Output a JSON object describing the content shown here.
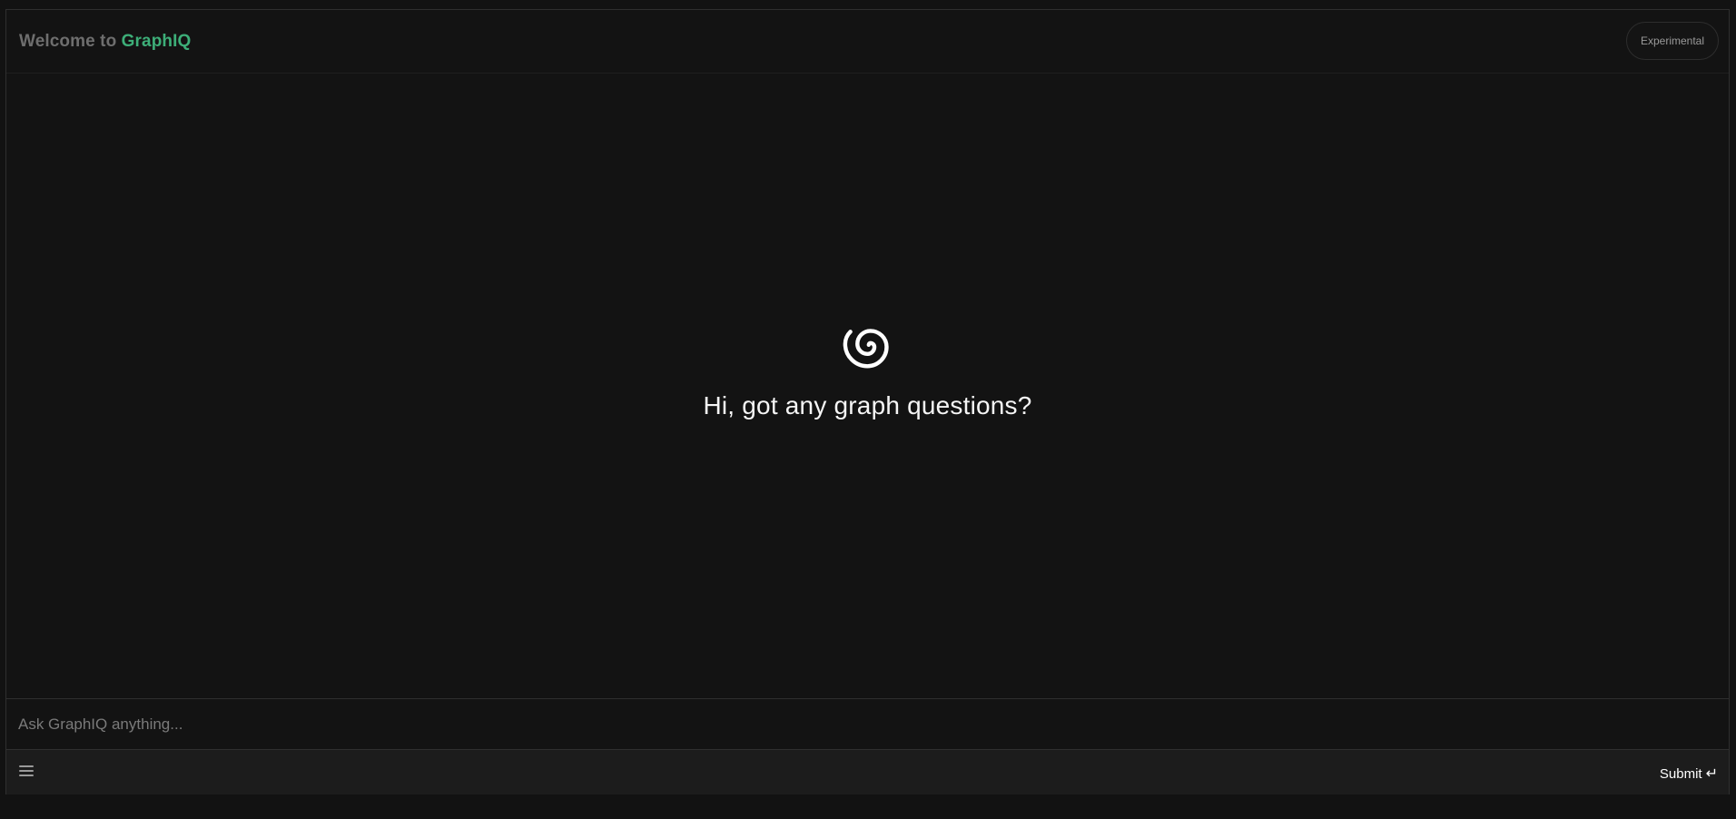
{
  "header": {
    "welcome_prefix": "Welcome to",
    "brand": "GraphIQ",
    "badge": "Experimental"
  },
  "main": {
    "logo_icon": "spiral-icon",
    "greeting": "Hi, got any graph questions?"
  },
  "composer": {
    "placeholder": "Ask GraphIQ anything...",
    "value": "",
    "menu_icon": "menu-icon",
    "submit_label": "Submit",
    "submit_icon": "↵"
  },
  "colors": {
    "background": "#121212",
    "brand": "#3dae78",
    "muted_text": "#6e6e6e",
    "footer": "#1c1c1c"
  }
}
